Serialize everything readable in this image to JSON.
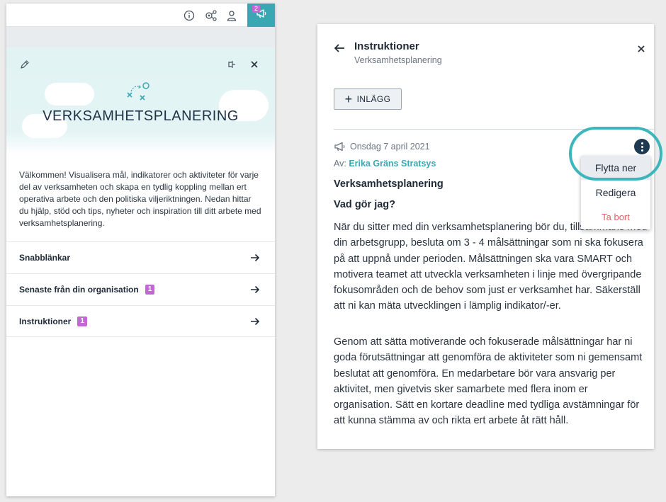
{
  "topbar": {
    "icons": [
      "info-icon",
      "settings-network-icon",
      "user-icon"
    ],
    "announce_icon": "megaphone-icon",
    "announce_badge": "2",
    "accent": "#3aa8b2"
  },
  "left_panel": {
    "hero": {
      "edit_icon": "pencil-icon",
      "pin_icon": "pin-icon",
      "close_icon": "close-icon",
      "logo_icon": "strategy-icon",
      "title": "VERKSAMHETSPLANERING"
    },
    "intro": "Välkommen! Visualisera mål, indikatorer och aktiviteter för varje del av verksamheten och skapa en tydlig koppling mellan ert operativa arbete och den politiska viljeriktningen.  Nedan hittar du hjälp, stöd och tips, nyheter och inspiration till ditt arbete med verksamhetsplanering.",
    "nav": [
      {
        "label": "Snabblänkar",
        "count": ""
      },
      {
        "label": "Senaste från din organisation",
        "count": "1"
      },
      {
        "label": "Instruktioner",
        "count": "1"
      }
    ],
    "badge_color": "#c467d6"
  },
  "right_panel": {
    "title": "Instruktioner",
    "subtitle": "Verksamhetsplanering",
    "add_button": "INLÄGG",
    "post": {
      "date": "Onsdag 7 april 2021",
      "author_prefix": "Av:",
      "author": "Erika Gräns Stratsys",
      "heading": "Verksamhetsplanering",
      "subheading": "Vad gör jag?",
      "paragraph1": "När du sitter med din verksamhetsplanering bör du, tillsammans med din arbetsgrupp, besluta om 3 - 4 målsättningar som ni ska fokusera på att uppnå under perioden. Målsättningen ska vara SMART och motivera teamet att utveckla verksamheten i linje med övergripande fokusområden och de behov som just er verksamhet har. Säkerställ att ni kan mäta utvecklingen i lämplig indikator/-er.",
      "paragraph2": "Genom att sätta motiverande och fokuserade målsättningar har ni goda förutsättningar att genomföra de aktiviteter som ni gemensamt beslutat att genomföra. En medarbetare bör vara ansvarig per aktivitet, men givetvis sker samarbete med flera inom er organisation. Sätt en kortare deadline med tydliga avstämningar för att kunna stämma av och rikta ert arbete åt rätt håll."
    },
    "menu": {
      "items": [
        "Flytta ner",
        "Redigera",
        "Ta bort"
      ],
      "danger_color": "#e0616a",
      "highlight_ring_color": "#3cb6ba"
    }
  }
}
